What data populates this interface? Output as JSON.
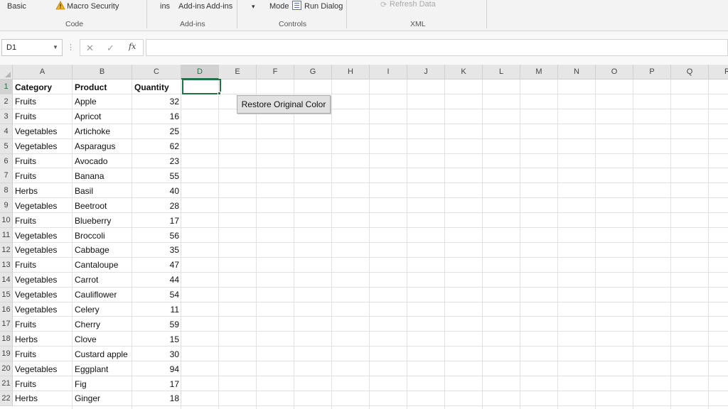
{
  "ribbon": {
    "basic_label": "Basic",
    "macro_security_label": "Macro Security",
    "code_group": "Code",
    "addins_label": "ins",
    "addins_button1": "Add-ins",
    "addins_button2": "Add-ins",
    "addins_group": "Add-ins",
    "dropdown_glyph": "▾",
    "mode_label": "Mode",
    "run_dialog_label": "Run Dialog",
    "controls_group": "Controls",
    "refresh_data_label": "Refresh Data",
    "xml_group": "XML",
    "icons": [
      "warning-icon",
      "dialog-icon",
      "refresh-icon"
    ]
  },
  "formula_bar": {
    "name_box": "D1",
    "dots": "⋮",
    "cancel_glyph": "✕",
    "enter_glyph": "✓",
    "fx_label": "fx",
    "formula": ""
  },
  "columns": [
    "A",
    "B",
    "C",
    "D",
    "E",
    "F",
    "G",
    "H",
    "I",
    "J",
    "K",
    "L",
    "M",
    "N",
    "O",
    "P",
    "Q",
    "R"
  ],
  "selected_column": "D",
  "selected_row": 1,
  "rows": [
    {
      "num": "1",
      "a": "Category",
      "b": "Product",
      "c": "Quantity"
    },
    {
      "num": "2",
      "a": "Fruits",
      "b": "Apple",
      "c": "32"
    },
    {
      "num": "3",
      "a": "Fruits",
      "b": "Apricot",
      "c": "16"
    },
    {
      "num": "4",
      "a": "Vegetables",
      "b": "Artichoke",
      "c": "25"
    },
    {
      "num": "5",
      "a": "Vegetables",
      "b": "Asparagus",
      "c": "62"
    },
    {
      "num": "6",
      "a": "Fruits",
      "b": "Avocado",
      "c": "23"
    },
    {
      "num": "7",
      "a": "Fruits",
      "b": "Banana",
      "c": "55"
    },
    {
      "num": "8",
      "a": "Herbs",
      "b": "Basil",
      "c": "40"
    },
    {
      "num": "9",
      "a": "Vegetables",
      "b": "Beetroot",
      "c": "28"
    },
    {
      "num": "10",
      "a": "Fruits",
      "b": "Blueberry",
      "c": "17"
    },
    {
      "num": "11",
      "a": "Vegetables",
      "b": "Broccoli",
      "c": "56"
    },
    {
      "num": "12",
      "a": "Vegetables",
      "b": "Cabbage",
      "c": "35"
    },
    {
      "num": "13",
      "a": "Fruits",
      "b": "Cantaloupe",
      "c": "47"
    },
    {
      "num": "14",
      "a": "Vegetables",
      "b": "Carrot",
      "c": "44"
    },
    {
      "num": "15",
      "a": "Vegetables",
      "b": "Cauliflower",
      "c": "54"
    },
    {
      "num": "16",
      "a": "Vegetables",
      "b": "Celery",
      "c": "11"
    },
    {
      "num": "17",
      "a": "Fruits",
      "b": "Cherry",
      "c": "59"
    },
    {
      "num": "18",
      "a": "Herbs",
      "b": "Clove",
      "c": "15"
    },
    {
      "num": "19",
      "a": "Fruits",
      "b": "Custard apple",
      "c": "30"
    },
    {
      "num": "20",
      "a": "Vegetables",
      "b": "Eggplant",
      "c": "94"
    },
    {
      "num": "21",
      "a": "Fruits",
      "b": "Fig",
      "c": "17"
    },
    {
      "num": "22",
      "a": "Herbs",
      "b": "Ginger",
      "c": "18"
    }
  ],
  "restore_button_label": "Restore Original Color",
  "colors": {
    "excel_green": "#217346",
    "header_bg": "#e6e6e6",
    "gridline": "#e1e1e1"
  }
}
